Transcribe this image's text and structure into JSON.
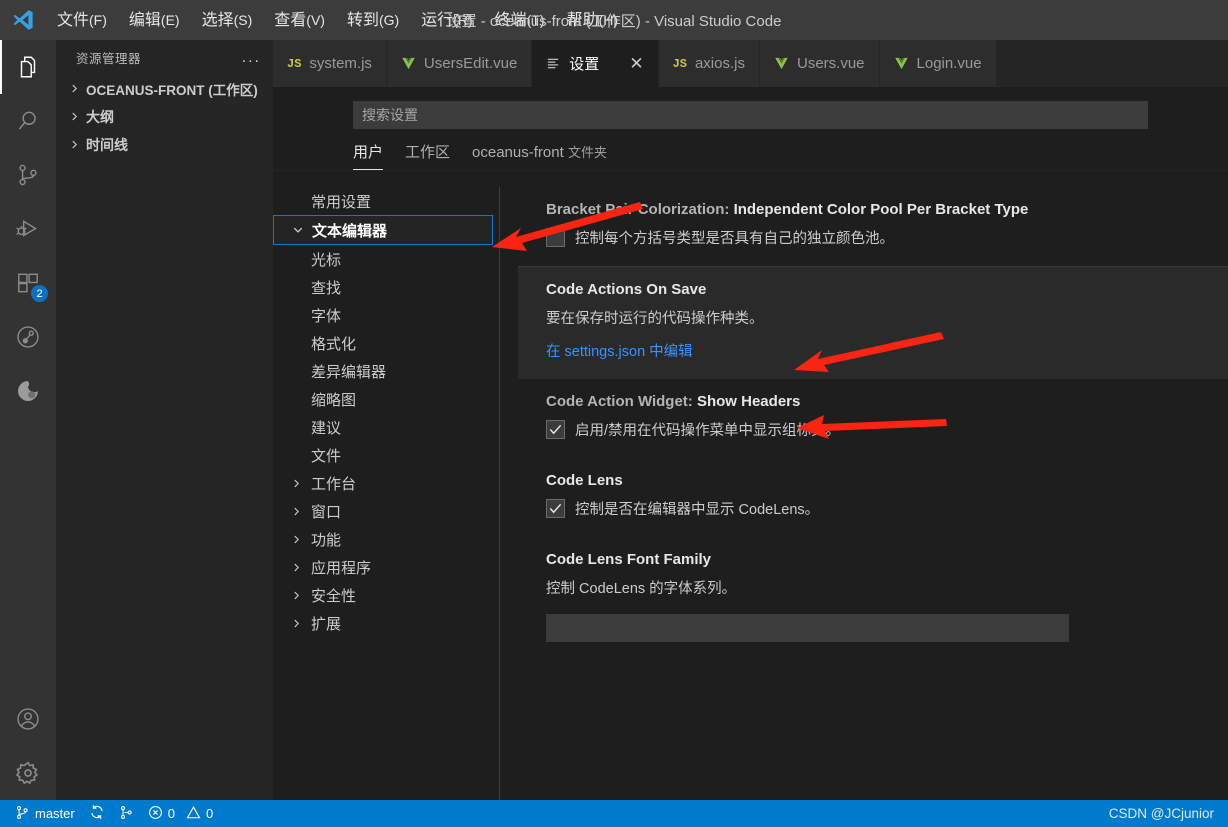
{
  "window": {
    "title": "设置 - oceanus-front (工作区) - Visual Studio Code"
  },
  "menubar": {
    "items": [
      {
        "label": "文件",
        "mnemonic": "(F)"
      },
      {
        "label": "编辑",
        "mnemonic": "(E)"
      },
      {
        "label": "选择",
        "mnemonic": "(S)"
      },
      {
        "label": "查看",
        "mnemonic": "(V)"
      },
      {
        "label": "转到",
        "mnemonic": "(G)"
      },
      {
        "label": "运行",
        "mnemonic": "(R)"
      },
      {
        "label": "终端",
        "mnemonic": "(T)"
      },
      {
        "label": "帮助",
        "mnemonic": "(H)"
      }
    ]
  },
  "activitybar": {
    "items": [
      {
        "name": "explorer",
        "icon": "files-icon",
        "active": true,
        "badge": ""
      },
      {
        "name": "search",
        "icon": "search-icon",
        "active": false,
        "badge": ""
      },
      {
        "name": "source-control",
        "icon": "source-control-icon",
        "active": false,
        "badge": ""
      },
      {
        "name": "run-debug",
        "icon": "run-debug-icon",
        "active": false,
        "badge": ""
      },
      {
        "name": "extensions",
        "icon": "extensions-icon",
        "active": false,
        "badge": "2"
      },
      {
        "name": "gitlens",
        "icon": "gitlens-icon",
        "active": false,
        "badge": ""
      },
      {
        "name": "remote-explorer",
        "icon": "circle-swirl-icon",
        "active": false,
        "badge": ""
      }
    ],
    "bottom": [
      {
        "name": "accounts",
        "icon": "account-icon"
      },
      {
        "name": "manage",
        "icon": "gear-icon"
      }
    ]
  },
  "sidebar": {
    "header_title": "资源管理器",
    "more_actions": "...",
    "tree": [
      {
        "label": "OCEANUS-FRONT (工作区)",
        "expanded": false,
        "bold": true
      },
      {
        "label": "大纲",
        "expanded": false,
        "bold": true
      },
      {
        "label": "时间线",
        "expanded": false,
        "bold": true
      }
    ]
  },
  "editor": {
    "tabs": [
      {
        "label": "system.js",
        "icon": "js-file-icon",
        "active": false,
        "closable": false
      },
      {
        "label": "UsersEdit.vue",
        "icon": "vue-file-icon",
        "active": false,
        "closable": false
      },
      {
        "label": "设置",
        "icon": "settings-list-icon",
        "active": true,
        "closable": true,
        "close_label": "✕"
      },
      {
        "label": "axios.js",
        "icon": "js-file-icon",
        "active": false,
        "closable": false
      },
      {
        "label": "Users.vue",
        "icon": "vue-file-icon",
        "active": false,
        "closable": false
      },
      {
        "label": "Login.vue",
        "icon": "vue-file-icon",
        "active": false,
        "closable": false
      }
    ]
  },
  "settings": {
    "search_placeholder": "搜索设置",
    "search_value": "",
    "scope_tabs": [
      {
        "label": "用户",
        "sub": "",
        "active": true
      },
      {
        "label": "工作区",
        "sub": "",
        "active": false
      },
      {
        "label": "oceanus-front",
        "sub": "文件夹",
        "active": false
      }
    ],
    "toc": [
      {
        "label": "常用设置",
        "level": 0,
        "arrow": "none",
        "focused": false
      },
      {
        "label": "文本编辑器",
        "level": 0,
        "arrow": "down",
        "focused": true
      },
      {
        "label": "光标",
        "level": 1,
        "arrow": "none",
        "focused": false
      },
      {
        "label": "查找",
        "level": 1,
        "arrow": "none",
        "focused": false
      },
      {
        "label": "字体",
        "level": 1,
        "arrow": "none",
        "focused": false
      },
      {
        "label": "格式化",
        "level": 1,
        "arrow": "none",
        "focused": false
      },
      {
        "label": "差异编辑器",
        "level": 1,
        "arrow": "none",
        "focused": false
      },
      {
        "label": "缩略图",
        "level": 1,
        "arrow": "none",
        "focused": false
      },
      {
        "label": "建议",
        "level": 1,
        "arrow": "none",
        "focused": false
      },
      {
        "label": "文件",
        "level": 1,
        "arrow": "none",
        "focused": false
      },
      {
        "label": "工作台",
        "level": 0,
        "arrow": "right",
        "focused": false
      },
      {
        "label": "窗口",
        "level": 0,
        "arrow": "right",
        "focused": false
      },
      {
        "label": "功能",
        "level": 0,
        "arrow": "right",
        "focused": false
      },
      {
        "label": "应用程序",
        "level": 0,
        "arrow": "right",
        "focused": false
      },
      {
        "label": "安全性",
        "level": 0,
        "arrow": "right",
        "focused": false
      },
      {
        "label": "扩展",
        "level": 0,
        "arrow": "right",
        "focused": false
      }
    ],
    "items": [
      {
        "category": "Bracket Pair Colorization:",
        "name": "Independent Color Pool Per Bracket Type",
        "control": "checkbox",
        "checked": false,
        "description": "控制每个方括号类型是否具有自己的独立颜色池。",
        "highlight": false
      },
      {
        "category": "",
        "name": "Code Actions On Save",
        "control": "link",
        "checked": false,
        "description": "要在保存时运行的代码操作种类。",
        "link_text": "在 settings.json 中编辑",
        "highlight": true
      },
      {
        "category": "Code Action Widget:",
        "name": "Show Headers",
        "control": "checkbox",
        "checked": true,
        "description": "启用/禁用在代码操作菜单中显示组标头。",
        "highlight": false
      },
      {
        "category": "",
        "name": "Code Lens",
        "control": "checkbox",
        "checked": true,
        "description": "控制是否在编辑器中显示 CodeLens。",
        "highlight": false
      },
      {
        "category": "",
        "name": "Code Lens Font Family",
        "control": "text",
        "checked": false,
        "description": "控制 CodeLens 的字体系列。",
        "input_value": "",
        "highlight": false
      }
    ]
  },
  "statusbar": {
    "branch": "master",
    "sync_icon": "sync-icon",
    "branch_icon": "git-branch-icon",
    "remote_icon": "source-control-icon",
    "errors": "0",
    "warnings": "0",
    "watermark": "CSDN @JCjunior"
  },
  "colors": {
    "accent": "#007acc",
    "focus_border": "#007fd4",
    "link": "#3794ff",
    "annotation": "#f92412"
  }
}
